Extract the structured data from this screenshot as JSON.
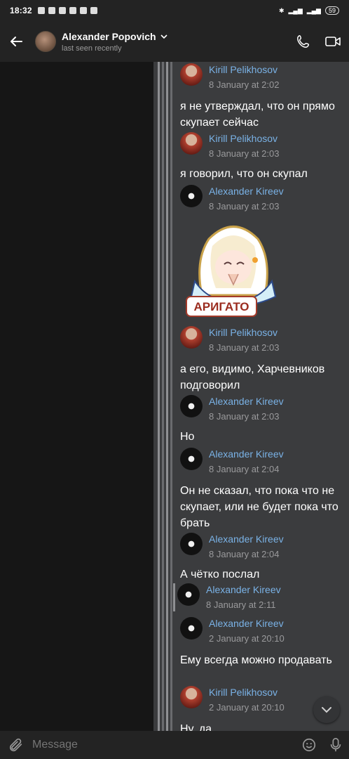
{
  "status_bar": {
    "time": "18:32",
    "signal": "‡‡‡",
    "battery": "59"
  },
  "header": {
    "contact_name": "Alexander Popovich",
    "contact_status": "last seen recently"
  },
  "messages": [
    {
      "sender": "Kirill Pelikhosov",
      "date": "8 January at 2:02",
      "text": "я не утверждал, что он прямо скупает сейчас",
      "avatar": "kirill"
    },
    {
      "sender": "Kirill Pelikhosov",
      "date": "8 January at 2:03",
      "text": "я говорил, что он скупал",
      "avatar": "kirill"
    },
    {
      "sender": "Alexander Kireev",
      "date": "8 January at 2:03",
      "text": "",
      "avatar": "kireev"
    },
    {
      "sender": "Kirill Pelikhosov",
      "date": "8 January at 2:03",
      "text": "а его, видимо, Харчевников подговорил",
      "avatar": "kirill"
    },
    {
      "sender": "Alexander Kireev",
      "date": "8 January at 2:03",
      "text": "Но",
      "avatar": "kireev"
    },
    {
      "sender": "Alexander Kireev",
      "date": "8 January at 2:04",
      "text": "Он не сказал, что пока что не скупает,  или не будет пока что брать",
      "avatar": "kireev"
    },
    {
      "sender": "Alexander Kireev",
      "date": "8 January at 2:04",
      "text": "А чётко послал",
      "avatar": "kireev"
    },
    {
      "sender": "Alexander Kireev",
      "date": "8 January at 2:11",
      "text": "",
      "avatar": "kireev"
    },
    {
      "sender": "Alexander Kireev",
      "date": "2 January at 20:10",
      "text": "Ему всегда можно продавать",
      "avatar": "kireev"
    },
    {
      "sender": "Kirill Pelikhosov",
      "date": "2 January at 20:10",
      "text": "Ну, да",
      "avatar": "kirill"
    }
  ],
  "sticker": {
    "caption": "АРИГАТО"
  },
  "input": {
    "placeholder": "Message"
  },
  "colors": {
    "accent_name": "#7ab2e6",
    "panel_bg": "#3b3c3e",
    "bar_bg": "#232323"
  }
}
